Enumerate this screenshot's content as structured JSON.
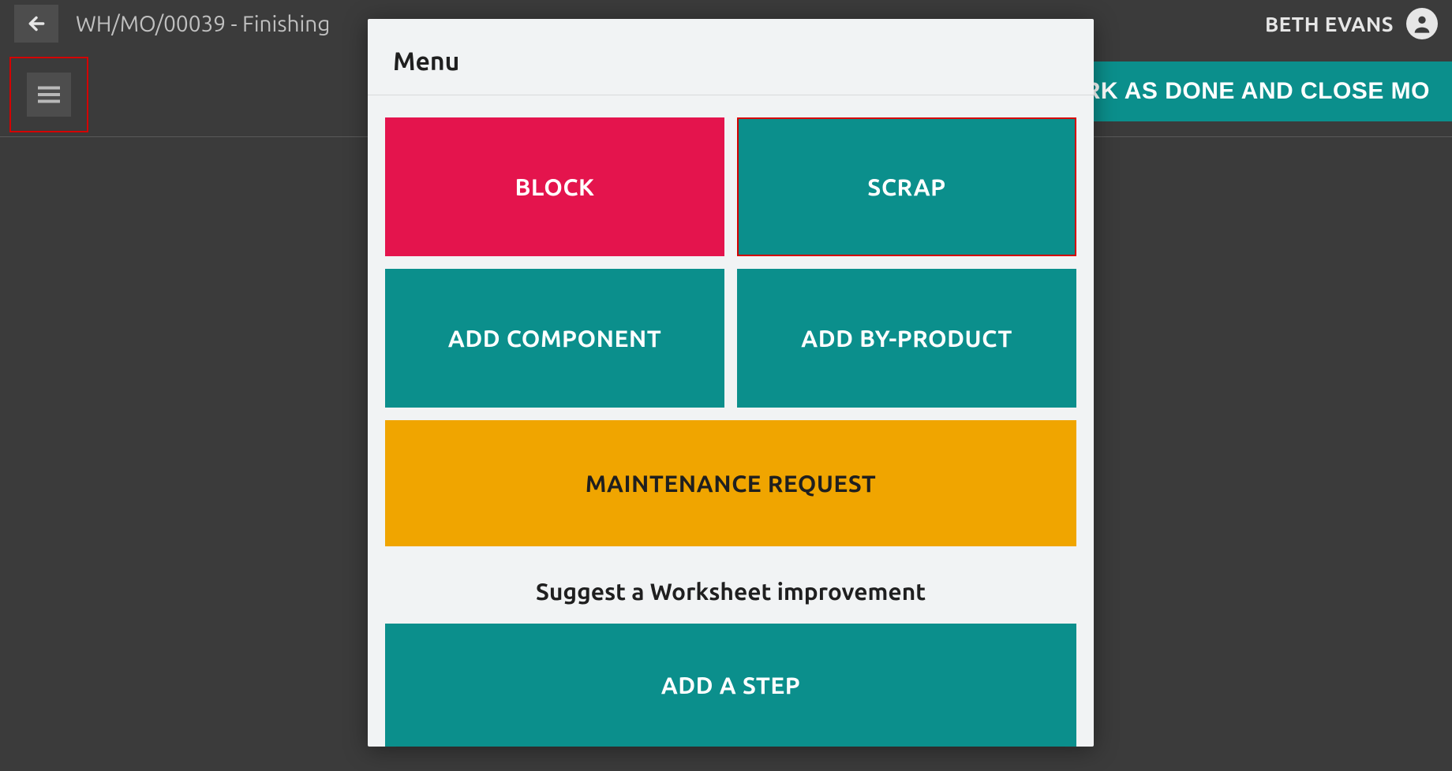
{
  "header": {
    "title": "WH/MO/00039 - Finishing",
    "user_name": "BETH EVANS"
  },
  "toolbar": {
    "mark_done_label": "ARK AS DONE AND CLOSE MO"
  },
  "menu": {
    "title": "Menu",
    "buttons": {
      "block": "BLOCK",
      "scrap": "SCRAP",
      "add_component": "ADD COMPONENT",
      "add_by_product": "ADD BY-PRODUCT",
      "maintenance": "MAINTENANCE REQUEST",
      "suggest_heading": "Suggest a Worksheet improvement",
      "add_step": "ADD A STEP"
    }
  }
}
